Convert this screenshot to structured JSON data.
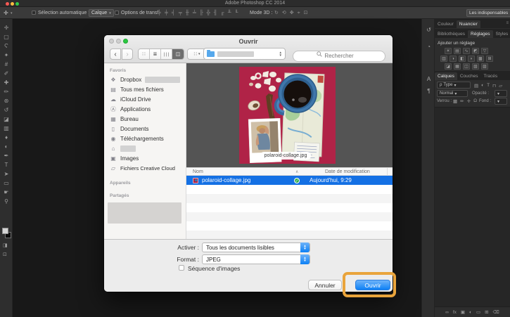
{
  "colors": {
    "selection_blue": "#1470e4",
    "button_blue_top": "#6eb3f9",
    "button_blue_bottom": "#0d80f5",
    "highlight_orange": "#e9a43c",
    "check_green": "#30ae4d",
    "photo_bg": "#b02347",
    "traffic_red": "#f75954",
    "traffic_yellow": "#fdbc40",
    "traffic_green": "#33c748",
    "dialog_green": "#2bc840",
    "dialog_gray": "#cfcfcf"
  },
  "app": {
    "title": "Adobe Photoshop CC 2014",
    "options_bar": {
      "tool_icon": "✛",
      "tool_caret": "▾",
      "auto_select_label": "Sélection automatique :",
      "auto_select_value": "Calque",
      "transform_label": "Options de transf.",
      "mode3d_label": "Mode 3D :",
      "workspace_value": "Les indispensables",
      "align_icons": [
        "╞",
        "╪",
        "╡",
        "╤",
        "╫",
        "╧",
        "╟",
        "╬",
        "╢",
        "╓",
        "╨",
        "╙"
      ],
      "mode3d_icons": [
        "↻",
        "⟲",
        "✥",
        "⌖",
        "⊡"
      ]
    },
    "tools": [
      {
        "name": "move",
        "glyph": "✛"
      },
      {
        "name": "marquee",
        "glyph": "▢"
      },
      {
        "name": "lasso",
        "glyph": "Ϛ"
      },
      {
        "name": "quick-selection",
        "glyph": "✦"
      },
      {
        "name": "crop",
        "glyph": "#"
      },
      {
        "name": "eyedropper",
        "glyph": "✐"
      },
      {
        "name": "healing-brush",
        "glyph": "✚"
      },
      {
        "name": "brush",
        "glyph": "✏"
      },
      {
        "name": "clone-stamp",
        "glyph": "⊛"
      },
      {
        "name": "history-brush",
        "glyph": "↺"
      },
      {
        "name": "eraser",
        "glyph": "◪"
      },
      {
        "name": "gradient",
        "glyph": "▥"
      },
      {
        "name": "blur",
        "glyph": "♦"
      },
      {
        "name": "dodge",
        "glyph": "◐"
      },
      {
        "name": "pen",
        "glyph": "✒"
      },
      {
        "name": "type",
        "glyph": "T"
      },
      {
        "name": "path-selection",
        "glyph": "➤"
      },
      {
        "name": "shape",
        "glyph": "▭"
      },
      {
        "name": "hand",
        "glyph": "☛"
      },
      {
        "name": "zoom",
        "glyph": "⚲"
      }
    ]
  },
  "dialog": {
    "title": "Ouvrir",
    "toolbar": {
      "back_icon": "‹",
      "forward_icon": "›",
      "views": [
        {
          "name": "icon-view",
          "glyph": "∷"
        },
        {
          "name": "list-view",
          "glyph": "≣"
        },
        {
          "name": "column-view",
          "glyph": "∣∣∣"
        },
        {
          "name": "coverflow-view",
          "glyph": "◫"
        }
      ],
      "arrange_icon": "∷",
      "arrange_caret": "▾",
      "stepper_up": "▲",
      "stepper_down": "▼",
      "search_placeholder": "Rechercher"
    },
    "sidebar": {
      "favorites_header": "Favoris",
      "devices_header": "Appareils",
      "shared_header": "Partagés",
      "items": [
        {
          "name": "dropbox",
          "icon": "❖",
          "label": "Dropbox"
        },
        {
          "name": "all-my-files",
          "icon": "▤",
          "label": "Tous mes fichiers"
        },
        {
          "name": "icloud-drive",
          "icon": "☁",
          "label": "iCloud Drive"
        },
        {
          "name": "applications",
          "icon": "Ⓐ",
          "label": "Applications"
        },
        {
          "name": "desktop",
          "icon": "▦",
          "label": "Bureau"
        },
        {
          "name": "documents",
          "icon": "▯",
          "label": "Documents"
        },
        {
          "name": "downloads",
          "icon": "◉",
          "label": "Téléchargements"
        },
        {
          "name": "home",
          "icon": "⌂",
          "label": ""
        },
        {
          "name": "images",
          "icon": "▣",
          "label": "Images"
        },
        {
          "name": "creative-cloud-files",
          "icon": "▱",
          "label": "Fichiers Creative Cloud"
        }
      ]
    },
    "preview": {
      "filename_label": "polaroid-collage.jpg"
    },
    "list": {
      "name_column": "Nom",
      "date_column": "Date de modification",
      "sort_icon": "∧",
      "file": {
        "name": "polaroid-collage.jpg",
        "date": "Aujourd'hui, 9:29",
        "badge": "✓"
      }
    },
    "form": {
      "enable_label": "Activer :",
      "enable_value": "Tous les documents lisibles",
      "format_label": "Format :",
      "format_value": "JPEG",
      "sequence_label": "Séquence d'images"
    },
    "buttons": {
      "cancel": "Annuler",
      "open": "Ouvrir"
    }
  },
  "panels": {
    "strip": [
      {
        "name": "history",
        "glyph": "↺"
      },
      {
        "name": "properties",
        "glyph": "◔"
      },
      {
        "name": "character",
        "glyph": "A"
      },
      {
        "name": "paragraph",
        "glyph": "¶"
      }
    ],
    "menu_icon": "≡",
    "color_tabs": [
      {
        "label": "Couleur"
      },
      {
        "label": "Nuancier"
      }
    ],
    "adjust_tabs": [
      {
        "label": "Bibliothèques"
      },
      {
        "label": "Réglages"
      },
      {
        "label": "Styles"
      }
    ],
    "adjustments_header": "Ajouter un réglage",
    "adjustment_rows": {
      "row1": [
        "☀",
        "▤",
        "∿",
        "◩",
        "▽"
      ],
      "row2": [
        "▥",
        "◑",
        "◧",
        "◗",
        "▩",
        "⊞"
      ],
      "row3": [
        "◪",
        "▦",
        "◫",
        "▧",
        "▨"
      ]
    },
    "layer_tabs": [
      {
        "label": "Calques"
      },
      {
        "label": "Couches"
      },
      {
        "label": "Tracés"
      }
    ],
    "layers": {
      "filter_prefix": "ρ",
      "filter_label": "Type",
      "caret": "▾",
      "filter_icons": [
        "▤",
        "◐",
        "T",
        "⊓",
        "▱"
      ],
      "blend_value": "Normal",
      "opacity_label": "Opacité :",
      "lock_label": "Verrou :",
      "lock_icons": [
        "▩",
        "✏",
        "✛",
        "Ω"
      ],
      "fill_label": "Fond :",
      "bottom_icons": [
        {
          "name": "link-layers",
          "glyph": "∞"
        },
        {
          "name": "layer-style",
          "glyph": "fx"
        },
        {
          "name": "add-mask",
          "glyph": "▣"
        },
        {
          "name": "new-adjustment",
          "glyph": "◐"
        },
        {
          "name": "new-group",
          "glyph": "▭"
        },
        {
          "name": "new-layer",
          "glyph": "⊞"
        },
        {
          "name": "delete-layer",
          "glyph": "⌫"
        }
      ]
    }
  }
}
